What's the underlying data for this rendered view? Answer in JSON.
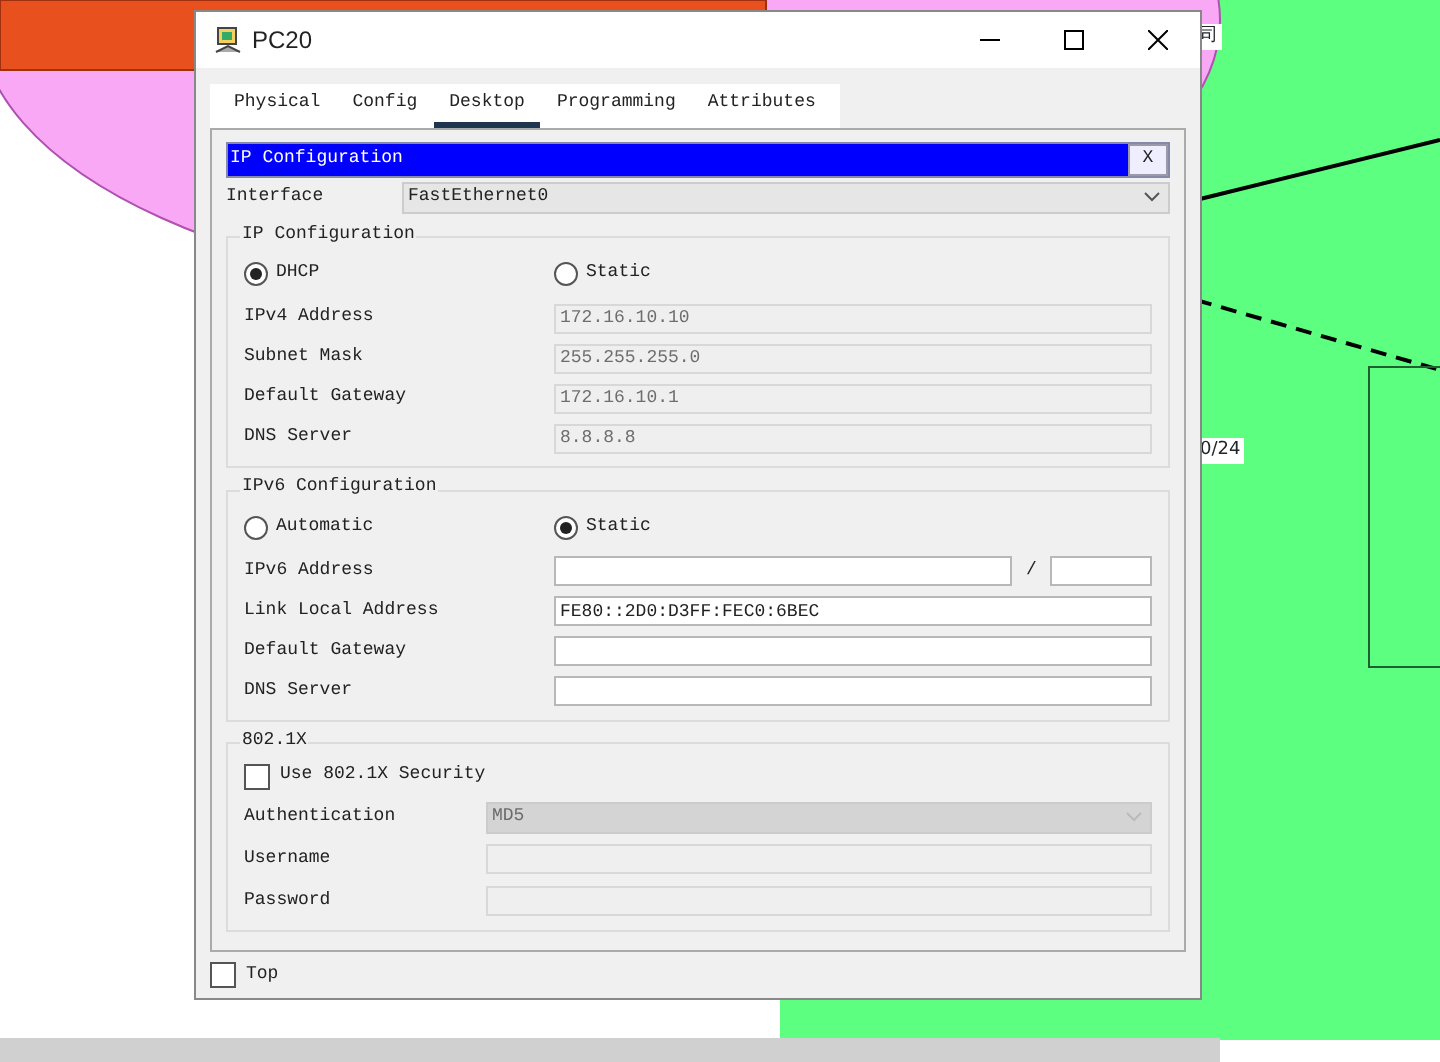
{
  "canvas_labels": [
    "司",
    "0/24"
  ],
  "window": {
    "title": "PC20"
  },
  "tabs": [
    {
      "label": "Physical",
      "selected": false
    },
    {
      "label": "Config",
      "selected": false
    },
    {
      "label": "Desktop",
      "selected": true
    },
    {
      "label": "Programming",
      "selected": false
    },
    {
      "label": "Attributes",
      "selected": false
    }
  ],
  "panel": {
    "title": "IP Configuration",
    "close": "X"
  },
  "interface": {
    "label": "Interface",
    "value": "FastEthernet0"
  },
  "groups": [
    {
      "title": "IP Configuration",
      "modes": [
        {
          "label": "DHCP",
          "selected": true
        },
        {
          "label": "Static",
          "selected": false
        }
      ],
      "fields": [
        {
          "kind": "text",
          "label": "IPv4 Address",
          "value": "172.16.10.10",
          "disabled": true
        },
        {
          "kind": "text",
          "label": "Subnet Mask",
          "value": "255.255.255.0",
          "disabled": true
        },
        {
          "kind": "text",
          "label": "Default Gateway",
          "value": "172.16.10.1",
          "disabled": true
        },
        {
          "kind": "text",
          "label": "DNS Server",
          "value": "8.8.8.8",
          "disabled": true
        }
      ]
    },
    {
      "title": "IPv6 Configuration",
      "modes": [
        {
          "label": "Automatic",
          "selected": false
        },
        {
          "label": "Static",
          "selected": true
        }
      ],
      "fields": [
        {
          "kind": "prefix",
          "label": "IPv6 Address",
          "separator": "/",
          "disabled": false
        },
        {
          "kind": "text",
          "label": "Link Local Address",
          "value": "FE80::2D0:D3FF:FEC0:6BEC",
          "disabled": false
        },
        {
          "kind": "text",
          "label": "Default Gateway",
          "disabled": false
        },
        {
          "kind": "text",
          "label": "DNS Server",
          "disabled": false
        }
      ]
    },
    {
      "title": "802.1X",
      "checkbox": {
        "label": "Use 802.1X Security",
        "checked": false
      },
      "fields": [
        {
          "kind": "select",
          "label": "Authentication",
          "value": "MD5",
          "disabled": true
        },
        {
          "kind": "text",
          "label": "Username",
          "disabled": true
        },
        {
          "kind": "text",
          "label": "Password",
          "disabled": true
        }
      ]
    }
  ],
  "top_checkbox": {
    "label": "Top",
    "checked": false
  }
}
